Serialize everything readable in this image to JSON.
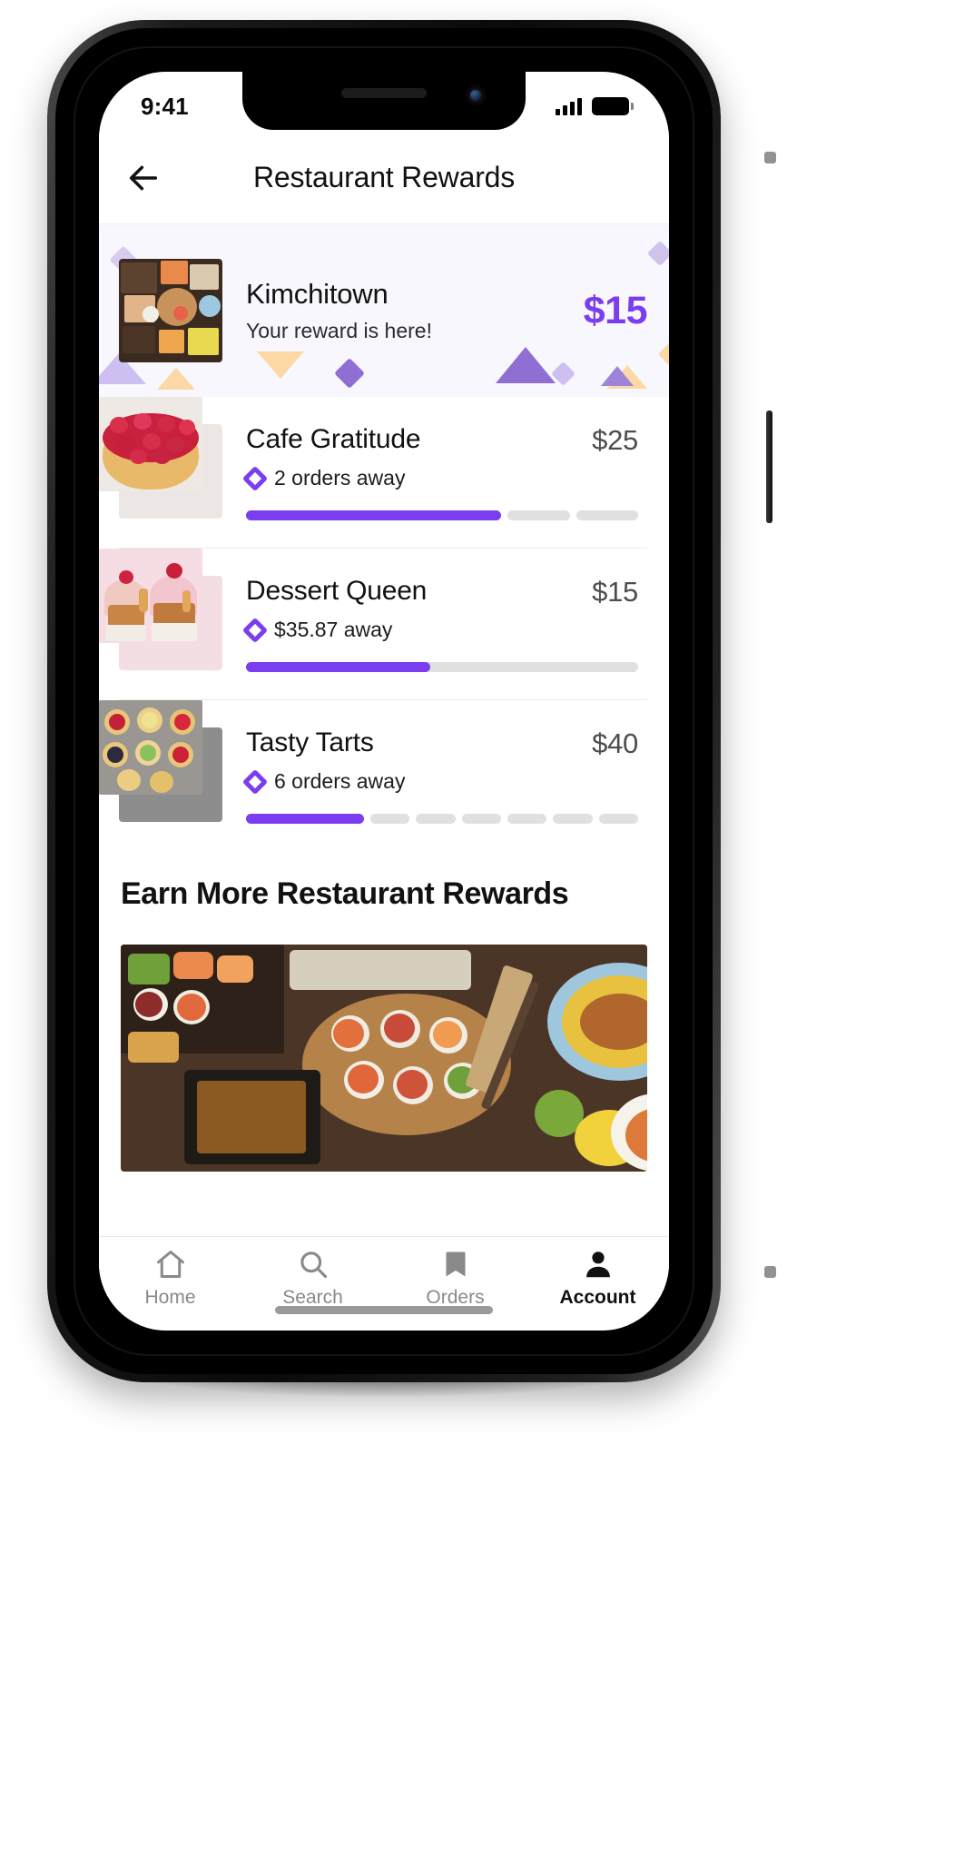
{
  "status_bar": {
    "time": "9:41",
    "signal_icon": "cellular-bars-icon",
    "battery_icon": "battery-full-icon"
  },
  "header": {
    "title": "Restaurant Rewards",
    "back_icon": "back-arrow-icon"
  },
  "featured": {
    "name": "Kimchitown",
    "subtitle": "Your reward is here!",
    "amount": "$15",
    "amount_color": "#7a3df0",
    "background_color": "#f8f7fd",
    "thumb_icon": "restaurant-photo"
  },
  "rewards": [
    {
      "name": "Cafe Gratitude",
      "amount": "$25",
      "status": "2 orders away",
      "status_icon": "diamond-icon",
      "progress_type": "segmented",
      "segments_total": 3,
      "segments_filled": 2,
      "thumb_icon": "raspberry-tart-photo"
    },
    {
      "name": "Dessert Queen",
      "amount": "$15",
      "status": "$35.87 away",
      "status_icon": "diamond-icon",
      "progress_type": "solid",
      "progress_percent": 47,
      "thumb_icon": "cupcake-photo"
    },
    {
      "name": "Tasty Tarts",
      "amount": "$40",
      "status": "6 orders away",
      "status_icon": "diamond-icon",
      "progress_type": "segmented",
      "segments_total": 7,
      "segments_filled": 3,
      "thumb_icon": "mini-tarts-photo"
    }
  ],
  "earn_more": {
    "title": "Earn More Restaurant Rewards",
    "promo_icon": "sushi-platter-photo"
  },
  "tabbar": {
    "items": [
      {
        "label": "Home",
        "icon": "home-icon",
        "active": false
      },
      {
        "label": "Search",
        "icon": "search-icon",
        "active": false
      },
      {
        "label": "Orders",
        "icon": "receipt-icon",
        "active": false
      },
      {
        "label": "Account",
        "icon": "person-icon",
        "active": true
      }
    ]
  },
  "theme": {
    "accent": "#7a3df0",
    "accent_light": "#a78bda",
    "peach": "#fcd9a4",
    "track": "#e0e0e0"
  }
}
